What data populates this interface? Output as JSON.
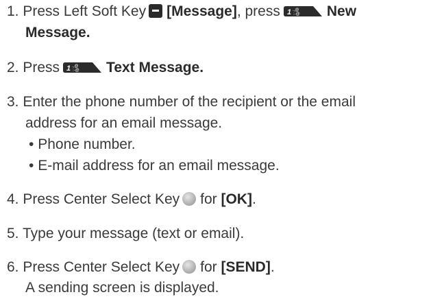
{
  "steps": {
    "s1": {
      "num": "1.",
      "pre": "Press Left Soft Key",
      "key": "[Message]",
      "mid": ", press",
      "opt_a": "New",
      "opt_b": "Message."
    },
    "s2": {
      "num": "2.",
      "pre": "Press",
      "opt": "Text Message."
    },
    "s3": {
      "num": "3.",
      "line_a": "Enter the phone number of the recipient or the email",
      "line_b": "address for an email message.",
      "bullets": [
        "Phone number.",
        "E-mail address for an email message."
      ]
    },
    "s4": {
      "num": "4.",
      "pre": "Press Center Select Key",
      "mid": "for",
      "key": "[OK]",
      "post": "."
    },
    "s5": {
      "num": "5.",
      "text": "Type your message (text or email)."
    },
    "s6": {
      "num": "6.",
      "pre": "Press Center Select Key",
      "mid": "for",
      "key": "[SEND]",
      "post": ".",
      "note": "A sending screen is displayed."
    }
  },
  "icons": {
    "left_soft_key": "left-soft-key-icon",
    "key_1": "key-1-icon",
    "center_select_key": "center-select-key-icon"
  },
  "colors": {
    "text": "#3a3a3a",
    "icon_dark": "#2b2b2b"
  }
}
